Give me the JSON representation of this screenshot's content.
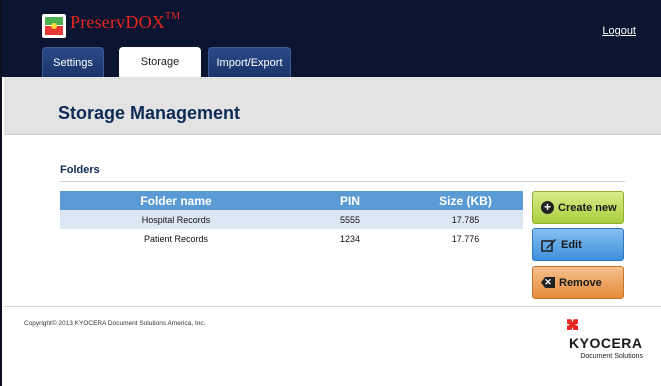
{
  "header": {
    "brand_name": "PreservDOX",
    "brand_tm": "TM",
    "logout_label": "Logout",
    "tabs": [
      {
        "label": "Settings",
        "active": false
      },
      {
        "label": "Storage",
        "active": true
      },
      {
        "label": "Import/Export",
        "active": false
      }
    ]
  },
  "page": {
    "title": "Storage Management",
    "section_label": "Folders"
  },
  "table": {
    "columns": [
      "Folder name",
      "PIN",
      "Size (KB)"
    ],
    "rows": [
      {
        "name": "Hospital Records",
        "pin": "5555",
        "size": "17.785",
        "selected": true
      },
      {
        "name": "Patient Records",
        "pin": "1234",
        "size": "17.776",
        "selected": false
      }
    ]
  },
  "buttons": {
    "create_label": "Create new",
    "edit_label": "Edit",
    "remove_label": "Remove"
  },
  "footer": {
    "copyright": "Copyright© 2013 KYOCERA Document Solutions America, Inc.",
    "brand_word": "KYOCERA",
    "brand_sub": "Document Solutions"
  },
  "colors": {
    "header_bg": "#0b1532",
    "brand_red": "#e6261f",
    "table_header": "#5b9bd5",
    "create_green": "#a9cf3c",
    "edit_blue": "#3d8fdc",
    "remove_orange": "#e58a3a"
  },
  "icons": [
    "app-logo-icon",
    "plus-circle-icon",
    "edit-pencil-icon",
    "remove-x-icon",
    "kyocera-mark-icon"
  ]
}
